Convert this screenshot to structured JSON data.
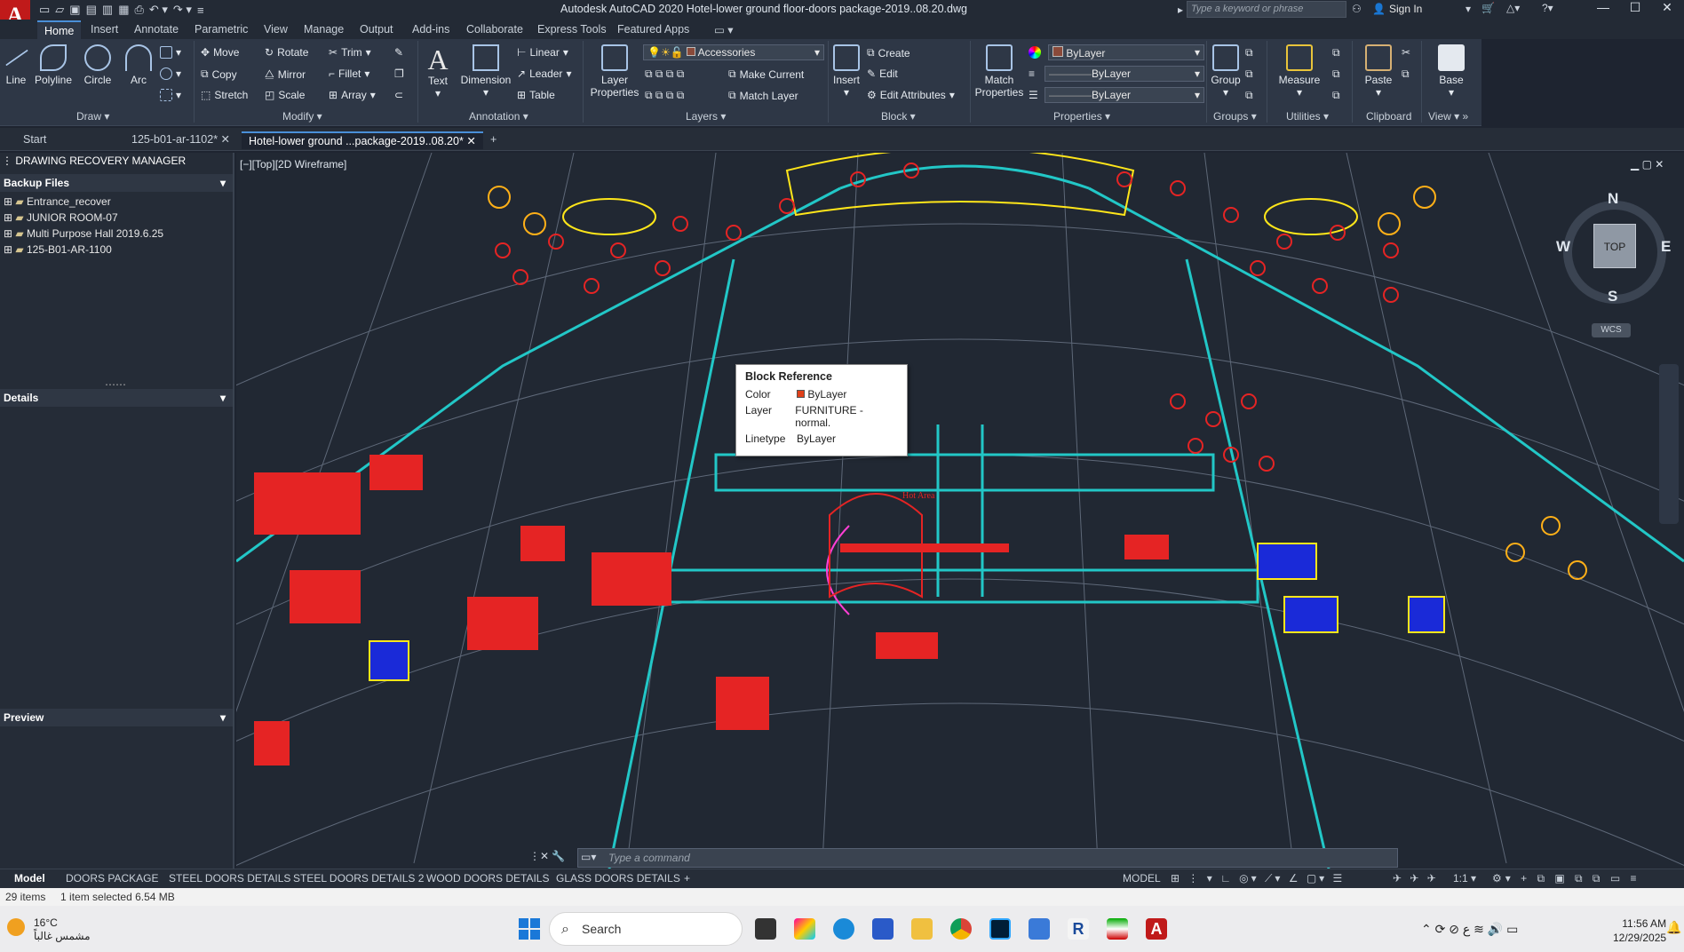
{
  "app": {
    "logo_letter": "A",
    "title": "Autodesk AutoCAD 2020   Hotel-lower ground floor-doors package-2019..08.20.dwg",
    "search_placeholder": "Type a keyword or phrase",
    "sign_in": "Sign In"
  },
  "ribbon_tabs": [
    "Home",
    "Insert",
    "Annotate",
    "Parametric",
    "View",
    "Manage",
    "Output",
    "Add-ins",
    "Collaborate",
    "Express Tools",
    "Featured Apps"
  ],
  "ribbon": {
    "draw": {
      "title": "Draw",
      "tools": [
        "Line",
        "Polyline",
        "Circle",
        "Arc"
      ]
    },
    "modify": {
      "title": "Modify",
      "tools": [
        "Move",
        "Rotate",
        "Trim",
        "Copy",
        "Mirror",
        "Fillet",
        "Stretch",
        "Scale",
        "Array"
      ]
    },
    "annotation": {
      "title": "Annotation",
      "tools": [
        "Text",
        "Dimension",
        "Linear",
        "Leader",
        "Table"
      ]
    },
    "layers": {
      "title": "Layers",
      "layer_properties": "Layer Properties",
      "current_layer": "Accessories",
      "make_current": "Make Current",
      "match_layer": "Match Layer"
    },
    "block": {
      "title": "Block",
      "insert": "Insert",
      "create": "Create",
      "edit": "Edit",
      "edit_attributes": "Edit Attributes"
    },
    "properties": {
      "title": "Properties",
      "match_properties": "Match Properties",
      "color": "ByLayer",
      "lineweight": "ByLayer",
      "linetype": "ByLayer"
    },
    "groups": {
      "title": "Groups",
      "group": "Group"
    },
    "utilities": {
      "title": "Utilities",
      "measure": "Measure"
    },
    "clipboard": {
      "title": "Clipboard",
      "paste": "Paste"
    },
    "view": {
      "title": "View",
      "base": "Base"
    }
  },
  "file_tabs": [
    "Start",
    "125-b01-ar-1102*",
    "Hotel-lower ground ...package-2019..08.20*"
  ],
  "side_panel": {
    "title": "DRAWING RECOVERY MANAGER",
    "backup_files": "Backup Files",
    "items": [
      "Entrance_recover",
      "JUNIOR ROOM-07",
      "Multi Purpose Hall 2019.6.25",
      "125-B01-AR-1100"
    ],
    "details": "Details",
    "preview": "Preview"
  },
  "viewport": {
    "label": "[−][Top][2D Wireframe]"
  },
  "canvas_labels": {
    "hot_area": "Hot Area"
  },
  "tooltip": {
    "title": "Block Reference",
    "rows": [
      {
        "key": "Color",
        "value": "ByLayer"
      },
      {
        "key": "Layer",
        "value": "FURNITURE - normal."
      },
      {
        "key": "Linetype",
        "value": "ByLayer"
      }
    ]
  },
  "viewcube": {
    "n": "N",
    "s": "S",
    "e": "E",
    "w": "W",
    "top": "TOP",
    "wcs": "WCS"
  },
  "command_line": {
    "placeholder": "Type  a  command"
  },
  "layout_tabs": [
    "Model",
    "DOORS PACKAGE",
    "STEEL DOORS DETAILS",
    "STEEL DOORS DETAILS 2",
    "WOOD DOORS DETAILS",
    "GLASS DOORS DETAILS"
  ],
  "status": {
    "model": "MODEL",
    "scale": "1:1"
  },
  "info_bar": {
    "items": "29 items",
    "selected": "1 item selected  6.54 MB"
  },
  "taskbar": {
    "weather_temp": "16°C",
    "weather_desc": "مشمس غالباً",
    "search": "Search",
    "time": "11:56 AM",
    "date": "12/29/2025"
  },
  "colors": {
    "accent": "#4a8fd8",
    "autocad_red": "#c01a1a",
    "canvas": "#212833"
  }
}
